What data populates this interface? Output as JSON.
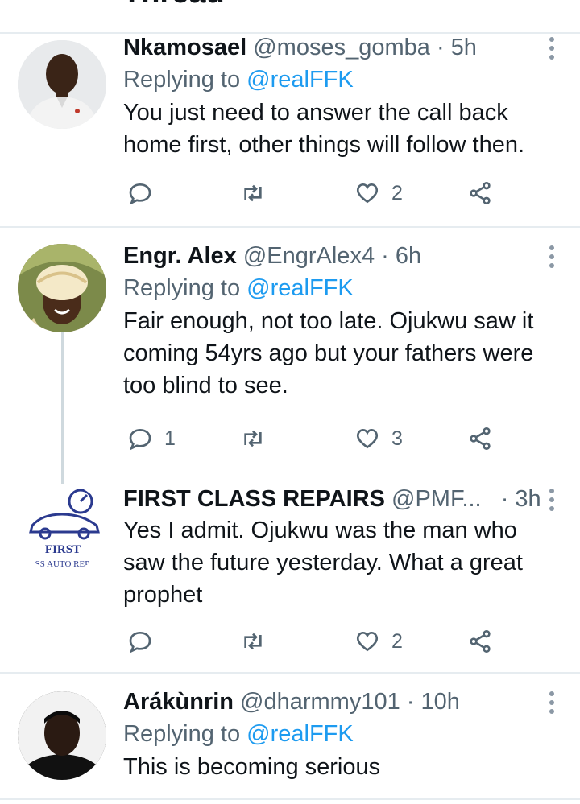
{
  "header": {
    "title": "Thread"
  },
  "tweets": [
    {
      "name": "Nkamosael",
      "handle": "@moses_gomba",
      "sep": "·",
      "time": "5h",
      "replying_prefix": "Replying to",
      "replying_to": "@realFFK",
      "text": "You just need to answer the call back home first, other things will follow then.",
      "replies": "",
      "retweets": "",
      "likes": "2"
    },
    {
      "name": "Engr. Alex",
      "handle": "@EngrAlex4",
      "sep": "·",
      "time": "6h",
      "replying_prefix": "Replying to",
      "replying_to": "@realFFK",
      "text": "Fair enough, not too late. Ojukwu saw it coming 54yrs ago but your fathers were too blind to see.",
      "replies": "1",
      "retweets": "",
      "likes": "3"
    },
    {
      "name": "FIRST CLASS REPAIRS",
      "handle": "@PMF...",
      "sep": "·",
      "time": "3h",
      "avatar_text_top": "FIRST",
      "avatar_text_bottom": "ASS AUTO REPA",
      "text": "Yes I admit. Ojukwu was the man who saw the future yesterday. What a great prophet",
      "replies": "",
      "retweets": "",
      "likes": "2"
    },
    {
      "name": "Arákùnrin",
      "handle": "@dharmmy101",
      "sep": "·",
      "time": "10h",
      "replying_prefix": "Replying to",
      "replying_to": "@realFFK",
      "text": "This is becoming serious"
    }
  ],
  "icons": {
    "reply": "reply-icon",
    "retweet": "retweet-icon",
    "like": "heart-icon",
    "share": "share-icon",
    "more": "more-vertical-icon"
  },
  "colors": {
    "link": "#1d9bf0",
    "secondary_text": "#536471",
    "divider": "#e6ecf0",
    "thread_line": "#cfd9de"
  }
}
